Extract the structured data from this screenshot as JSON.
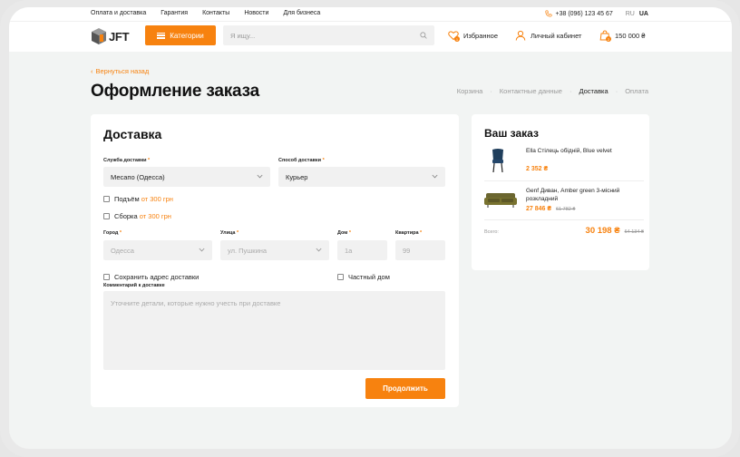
{
  "topbar": {
    "links": [
      "Оплата и доставка",
      "Гарантия",
      "Контакты",
      "Новости",
      "Для бизнеса"
    ],
    "phone": "+38 (096) 123 45 67",
    "lang": [
      "RU",
      "UA"
    ]
  },
  "header": {
    "logo": "JFT",
    "categories_label": "Категории",
    "search_placeholder": "Я ищу...",
    "favorites_label": "Избранное",
    "favorites_count": "1",
    "account_label": "Личный кабинет",
    "cart_total": "150 000 ₴",
    "cart_count": "2"
  },
  "page": {
    "back_label": "Вернуться назад",
    "title": "Оформление заказа",
    "steps": [
      "Корзина",
      "Контактные данные",
      "Доставка",
      "Оплата"
    ],
    "active_step": "Доставка"
  },
  "delivery": {
    "title": "Доставка",
    "service_label": "Служба доставки",
    "service_value": "Месапо (Одесса)",
    "method_label": "Способ доставки",
    "method_value": "Курьер",
    "lift_label": "Подъём",
    "lift_price": "от 300 грн",
    "assembly_label": "Сборка",
    "assembly_price": "от 300 грн",
    "city_label": "Город",
    "city_value": "Одесса",
    "street_label": "Улица",
    "street_value": "ул. Пушкина",
    "house_label": "Дом",
    "house_placeholder": "1а",
    "apt_label": "Квартира",
    "apt_placeholder": "99",
    "save_address_label": "Сохранить адрес доставки",
    "private_house_label": "Частный дом",
    "comment_label": "Комментарий к доставке",
    "comment_placeholder": "Уточните детали, которые нужно учесть при доставке",
    "submit_label": "Продолжить",
    "required_mark": "*"
  },
  "order": {
    "title": "Ваш заказ",
    "items": [
      {
        "name": "Ella Стілець обідній, Blue velvet",
        "price": "2 352 ₴",
        "old_price": ""
      },
      {
        "name": "Genf Диван, Amber green 3-місний розкладний",
        "price": "27 846 ₴",
        "old_price": "61 782 ₴"
      }
    ],
    "total_label": "Всего:",
    "total": "30 198 ₴",
    "total_old": "64 134 ₴"
  },
  "colors": {
    "accent": "#f7820f",
    "background": "#f2f4f3"
  }
}
